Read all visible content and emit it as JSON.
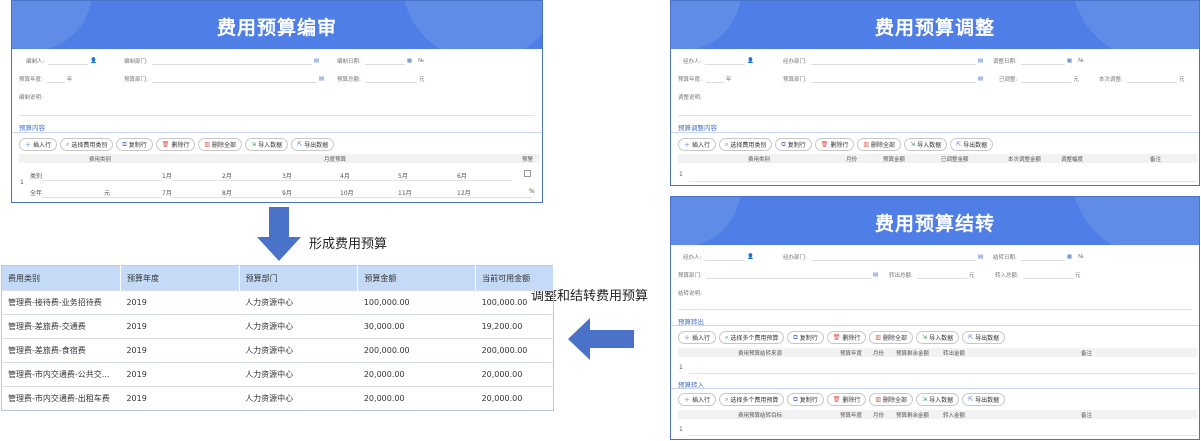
{
  "panel_review": {
    "title": "费用预算编审",
    "fields": {
      "preparer": "编制人:",
      "dept": "编制部门:",
      "date": "编制日期:",
      "no": "№",
      "year": "预算年度:",
      "year_unit": "年",
      "budget_dept": "预算部门:",
      "total": "预算总额:",
      "total_unit": "元",
      "desc": "编制说明:"
    },
    "section": "预算内容",
    "toolbar": [
      "插入行",
      "选择费用类别",
      "复制行",
      "删除行",
      "删除全部",
      "导入数据",
      "导出数据"
    ],
    "grid_headers": [
      "费用类别",
      "月度预算",
      "预警"
    ],
    "row_index": "1",
    "row_labels": [
      "类别",
      "全年"
    ],
    "row_unit_yuan": "元",
    "months_row1": [
      "1月",
      "2月",
      "3月",
      "4月",
      "5月",
      "6月"
    ],
    "months_row2": [
      "7月",
      "8月",
      "9月",
      "10月",
      "11月",
      "12月"
    ],
    "percent": "%"
  },
  "panel_adjust": {
    "title": "费用预算调整",
    "fields": {
      "handler": "经办人:",
      "handler_dept": "经办部门:",
      "adjust_date": "调整日期:",
      "no": "№",
      "year": "预算年度:",
      "year_unit": "年",
      "budget_dept": "预算部门:",
      "adjusted": "已调整:",
      "adjusted_unit": "元",
      "this_adjust": "本次调整:",
      "this_adjust_unit": "元",
      "desc": "调整说明:"
    },
    "section": "预算调整内容",
    "toolbar": [
      "插入行",
      "选择费用类别",
      "复制行",
      "删除行",
      "删除全部",
      "导入数据",
      "导出数据"
    ],
    "grid_headers": [
      "费用类别",
      "月份",
      "预算金额",
      "已调整金额",
      "本次调整金额",
      "调整幅度",
      "备注"
    ],
    "row_index": "1"
  },
  "panel_transfer": {
    "title": "费用预算结转",
    "fields": {
      "handler": "经办人:",
      "handler_dept": "经办部门:",
      "transfer_date": "结转日期:",
      "no": "№",
      "budget_dept": "预算部门:",
      "out_total": "转出总额:",
      "out_unit": "元",
      "in_total": "转入总额:",
      "in_unit": "元",
      "desc": "结转说明:"
    },
    "section_out": "预算转出",
    "section_in": "预算转入",
    "toolbar": [
      "插入行",
      "选择多个费用预算",
      "复制行",
      "删除行",
      "删除全部",
      "导入数据",
      "导出数据"
    ],
    "grid_out_headers": [
      "费用预算结转来源",
      "预算年度",
      "月份",
      "预算剩余金额",
      "转出金额",
      "备注"
    ],
    "grid_in_headers": [
      "费用预算结转目标",
      "预算年度",
      "月份",
      "预算剩余金额",
      "转入金额",
      "备注"
    ],
    "row_index": "1"
  },
  "labels": {
    "form_budget": "形成费用预算",
    "adjust_transfer": "调整和结转费用预算"
  },
  "budget_table": {
    "headers": [
      "费用类别",
      "预算年度",
      "预算部门",
      "预算金额",
      "当前可用金额"
    ],
    "rows": [
      [
        "管理费-接待费-业务招待费",
        "2019",
        "人力资源中心",
        "100,000.00",
        "100,000.00"
      ],
      [
        "管理费-差旅费-交通费",
        "2019",
        "人力资源中心",
        "30,000.00",
        "19,200.00"
      ],
      [
        "管理费-差旅费-食宿费",
        "2019",
        "人力资源中心",
        "200,000.00",
        "200,000.00"
      ],
      [
        "管理费-市内交通费-公共交...",
        "2019",
        "人力资源中心",
        "20,000.00",
        "20,000.00"
      ],
      [
        "管理费-市内交通费-出租车费",
        "2019",
        "人力资源中心",
        "20,000.00",
        "20,000.00"
      ]
    ]
  },
  "colors": {
    "header_blue": "#4f7fe6",
    "arrow_blue": "#4a72c8",
    "table_header": "#c4daf7"
  }
}
